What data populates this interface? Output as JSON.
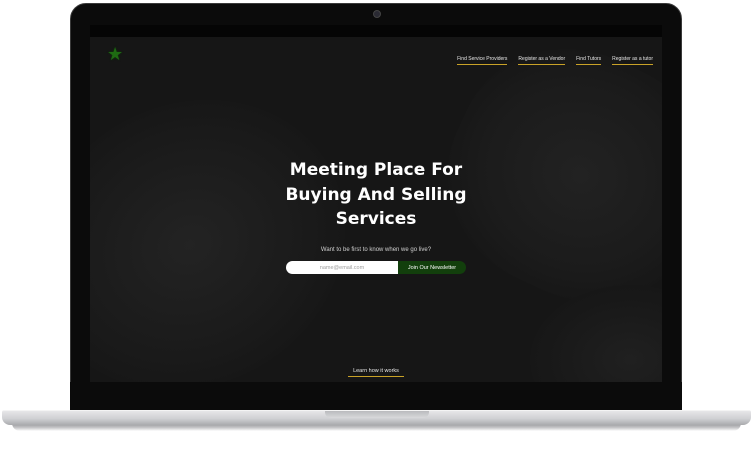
{
  "brand": {
    "logo_text": "",
    "accent": "#c9a227",
    "green": "#123f0c"
  },
  "nav": {
    "items": [
      {
        "label": "Find Service Providers"
      },
      {
        "label": "Register as a Vendor"
      },
      {
        "label": "Find Tutors"
      },
      {
        "label": "Register as a tutor"
      }
    ]
  },
  "hero": {
    "title_line1": "Meeting Place For",
    "title_line2": "Buying And Selling",
    "title_line3": "Services",
    "subtitle": "Want to be first to know when we go live?"
  },
  "signup": {
    "email_placeholder": "name@email.com",
    "button_label": "Join Our Newsletter"
  },
  "footer": {
    "learn_label": "Learn how it works"
  },
  "icons": [
    "logo-star-icon",
    "camera-icon"
  ]
}
